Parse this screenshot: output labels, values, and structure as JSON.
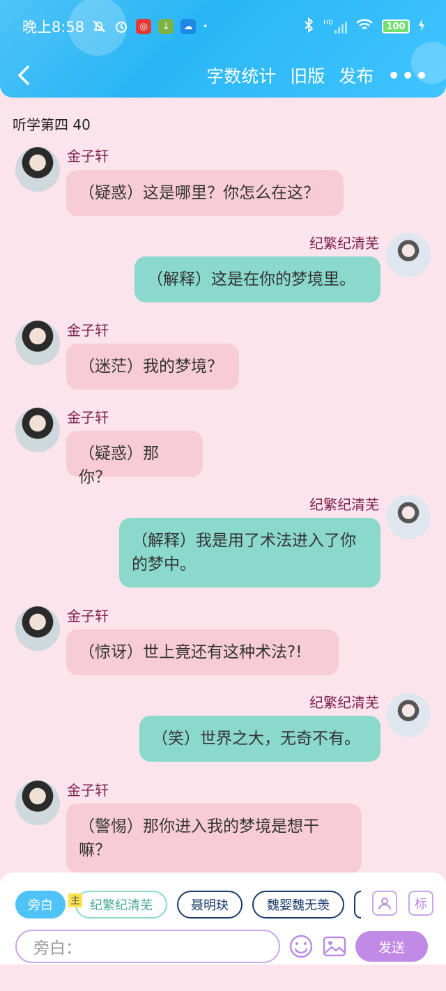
{
  "status_bar": {
    "time": "晚上8:58",
    "battery": "100",
    "network": "HD"
  },
  "nav": {
    "actions": [
      "字数统计",
      "旧版",
      "发布"
    ],
    "more": "•••"
  },
  "chat": {
    "title": "听学第四 40",
    "messages": [
      {
        "side": "left",
        "sender": "金子轩",
        "text": "（疑惑）这是哪里？你怎么在这？"
      },
      {
        "side": "right",
        "sender": "纪繁纪清芜",
        "text": "（解释）这是在你的梦境里。"
      },
      {
        "side": "left",
        "sender": "金子轩",
        "text": "（迷茫）我的梦境？"
      },
      {
        "side": "left",
        "sender": "金子轩",
        "text": "（疑惑）那你？"
      },
      {
        "side": "right",
        "sender": "纪繁纪清芜",
        "text": "（解释）我是用了术法进入了你的梦中。"
      },
      {
        "side": "left",
        "sender": "金子轩",
        "text": "（惊讶）世上竟还有这种术法?!"
      },
      {
        "side": "right",
        "sender": "纪繁纪清芜",
        "text": "（笑）世界之大，无奇不有。"
      },
      {
        "side": "left",
        "sender": "金子轩",
        "text": "（警惕）那你进入我的梦境是想干嘛？"
      }
    ]
  },
  "bottom": {
    "roles": [
      "旁白",
      "纪繁纪清芜",
      "聂明玦",
      "魏婴魏无羡"
    ],
    "main_tag": "主",
    "tag_button": "标",
    "input_placeholder": "旁白：",
    "send": "发送"
  },
  "colors": {
    "header": "#29b6f6",
    "background": "#fce4ec",
    "left_bubble": "#f8ccd6",
    "right_bubble": "#8ad9cc",
    "sender_name": "#7b1f4d",
    "send_button": "#c08ae6"
  }
}
